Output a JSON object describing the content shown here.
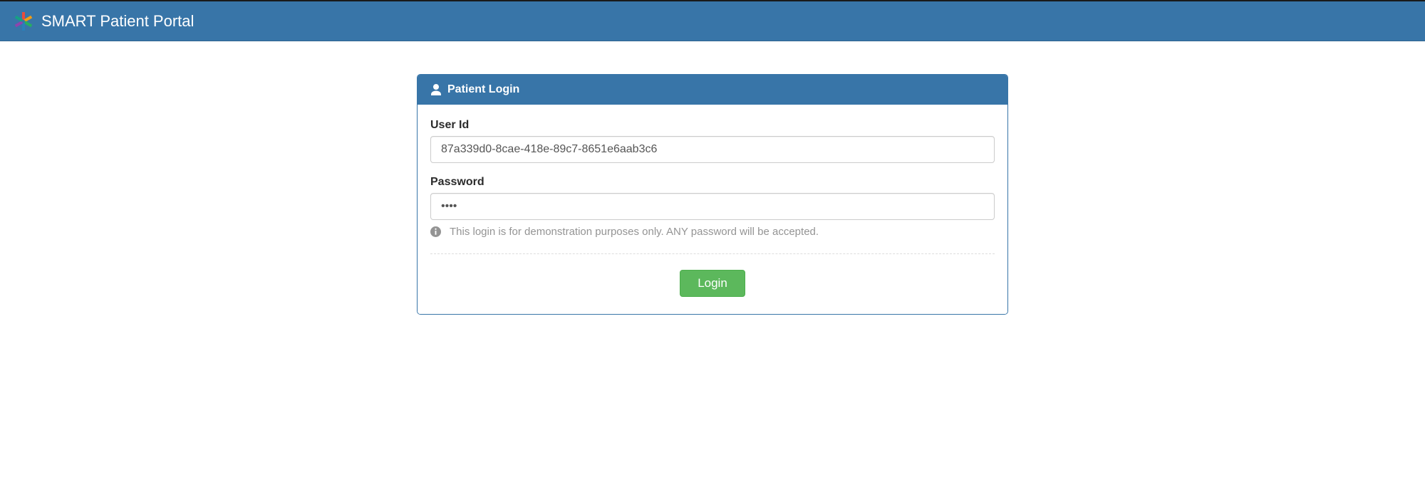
{
  "navbar": {
    "title": "SMART Patient Portal"
  },
  "panel": {
    "heading": "Patient Login"
  },
  "form": {
    "user_id": {
      "label": "User Id",
      "value": "87a339d0-8cae-418e-89c7-8651e6aab3c6"
    },
    "password": {
      "label": "Password",
      "value": "••••"
    },
    "help_text": "This login is for demonstration purposes only. ANY password will be accepted.",
    "login_button": "Login"
  }
}
